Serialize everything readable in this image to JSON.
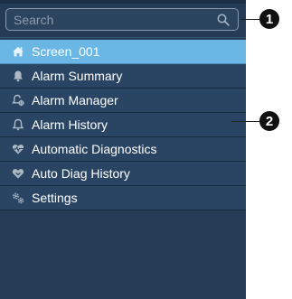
{
  "search": {
    "placeholder": "Search",
    "icon": "search-icon"
  },
  "menu": {
    "items": [
      {
        "label": "Screen_001",
        "icon": "home-icon",
        "active": true
      },
      {
        "label": "Alarm Summary",
        "icon": "bell-icon",
        "active": false
      },
      {
        "label": "Alarm Manager",
        "icon": "bell-settings-icon",
        "active": false
      },
      {
        "label": "Alarm History",
        "icon": "bell-history-icon",
        "active": false
      },
      {
        "label": "Automatic Diagnostics",
        "icon": "heart-pulse-icon",
        "active": false
      },
      {
        "label": "Auto Diag History",
        "icon": "heart-history-icon",
        "active": false
      },
      {
        "label": "Settings",
        "icon": "gears-icon",
        "active": false
      }
    ]
  },
  "callouts": [
    "1",
    "2"
  ],
  "colors": {
    "sidebar_bg": "#243c56",
    "item_bg": "#2a4563",
    "active_bg": "#6ab7e6",
    "icon": "#aeb9c6"
  }
}
